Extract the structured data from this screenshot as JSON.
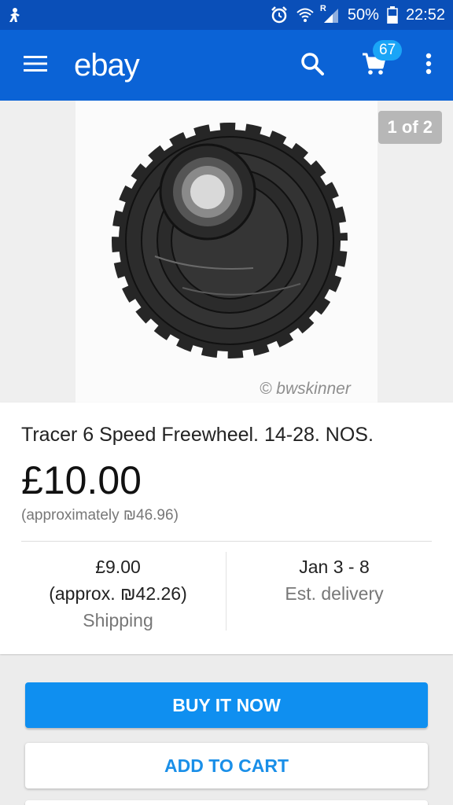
{
  "status_bar": {
    "battery": "50%",
    "time": "22:52",
    "roaming": "R"
  },
  "app_bar": {
    "logo": "ebay",
    "cart_count": "67",
    "color": "#0b63d6"
  },
  "gallery": {
    "counter": "1 of 2",
    "watermark": "© bwskinner"
  },
  "listing": {
    "title": "Tracer 6 Speed Freewheel. 14-28. NOS.",
    "price": "£10.00",
    "approx_price": "(approximately ₪46.96)",
    "shipping_cost": "£9.00",
    "shipping_approx": "(approx. ₪42.26)",
    "shipping_label": "Shipping",
    "delivery_dates": "Jan 3 - 8",
    "delivery_label": "Est. delivery"
  },
  "actions": {
    "buy_now": "BUY IT NOW",
    "add_to_cart": "ADD TO CART"
  },
  "icons": [
    "notification-icon",
    "alarm-icon",
    "wifi-icon",
    "signal-icon",
    "battery-icon",
    "menu-icon",
    "search-icon",
    "cart-icon",
    "more-vert-icon"
  ]
}
